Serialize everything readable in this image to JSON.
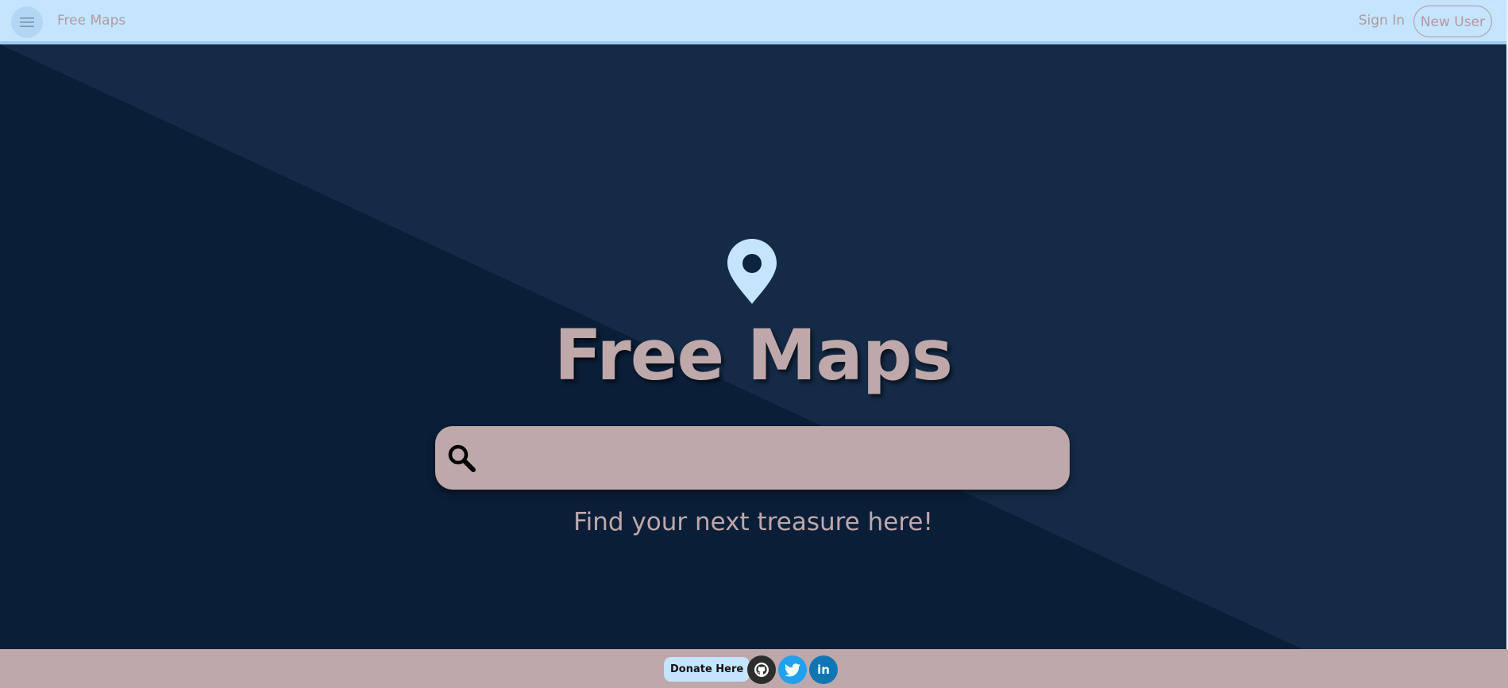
{
  "navbar": {
    "brand": "Free Maps",
    "sign_in": "Sign In",
    "new_user": "New User",
    "menu_icon": "hamburger-menu-icon"
  },
  "hero": {
    "pin_icon": "location-pin-icon",
    "title": "Free Maps",
    "search": {
      "icon": "search-icon",
      "value": "",
      "placeholder": ""
    },
    "tagline": "Find your next treasure here!"
  },
  "footer": {
    "donate": "Donate Here",
    "github_icon": "github-icon",
    "twitter_icon": "twitter-icon",
    "linkedin": "in"
  },
  "colors": {
    "navbar_bg": "#c5e4fe",
    "hero_dark": "#0a1e38",
    "hero_light": "#142a46",
    "accent_text": "#bfa8a9",
    "pin": "#c5e4fe",
    "twitter": "#1da1f2",
    "linkedin": "#0d77b5",
    "github": "#2d2d2d"
  }
}
